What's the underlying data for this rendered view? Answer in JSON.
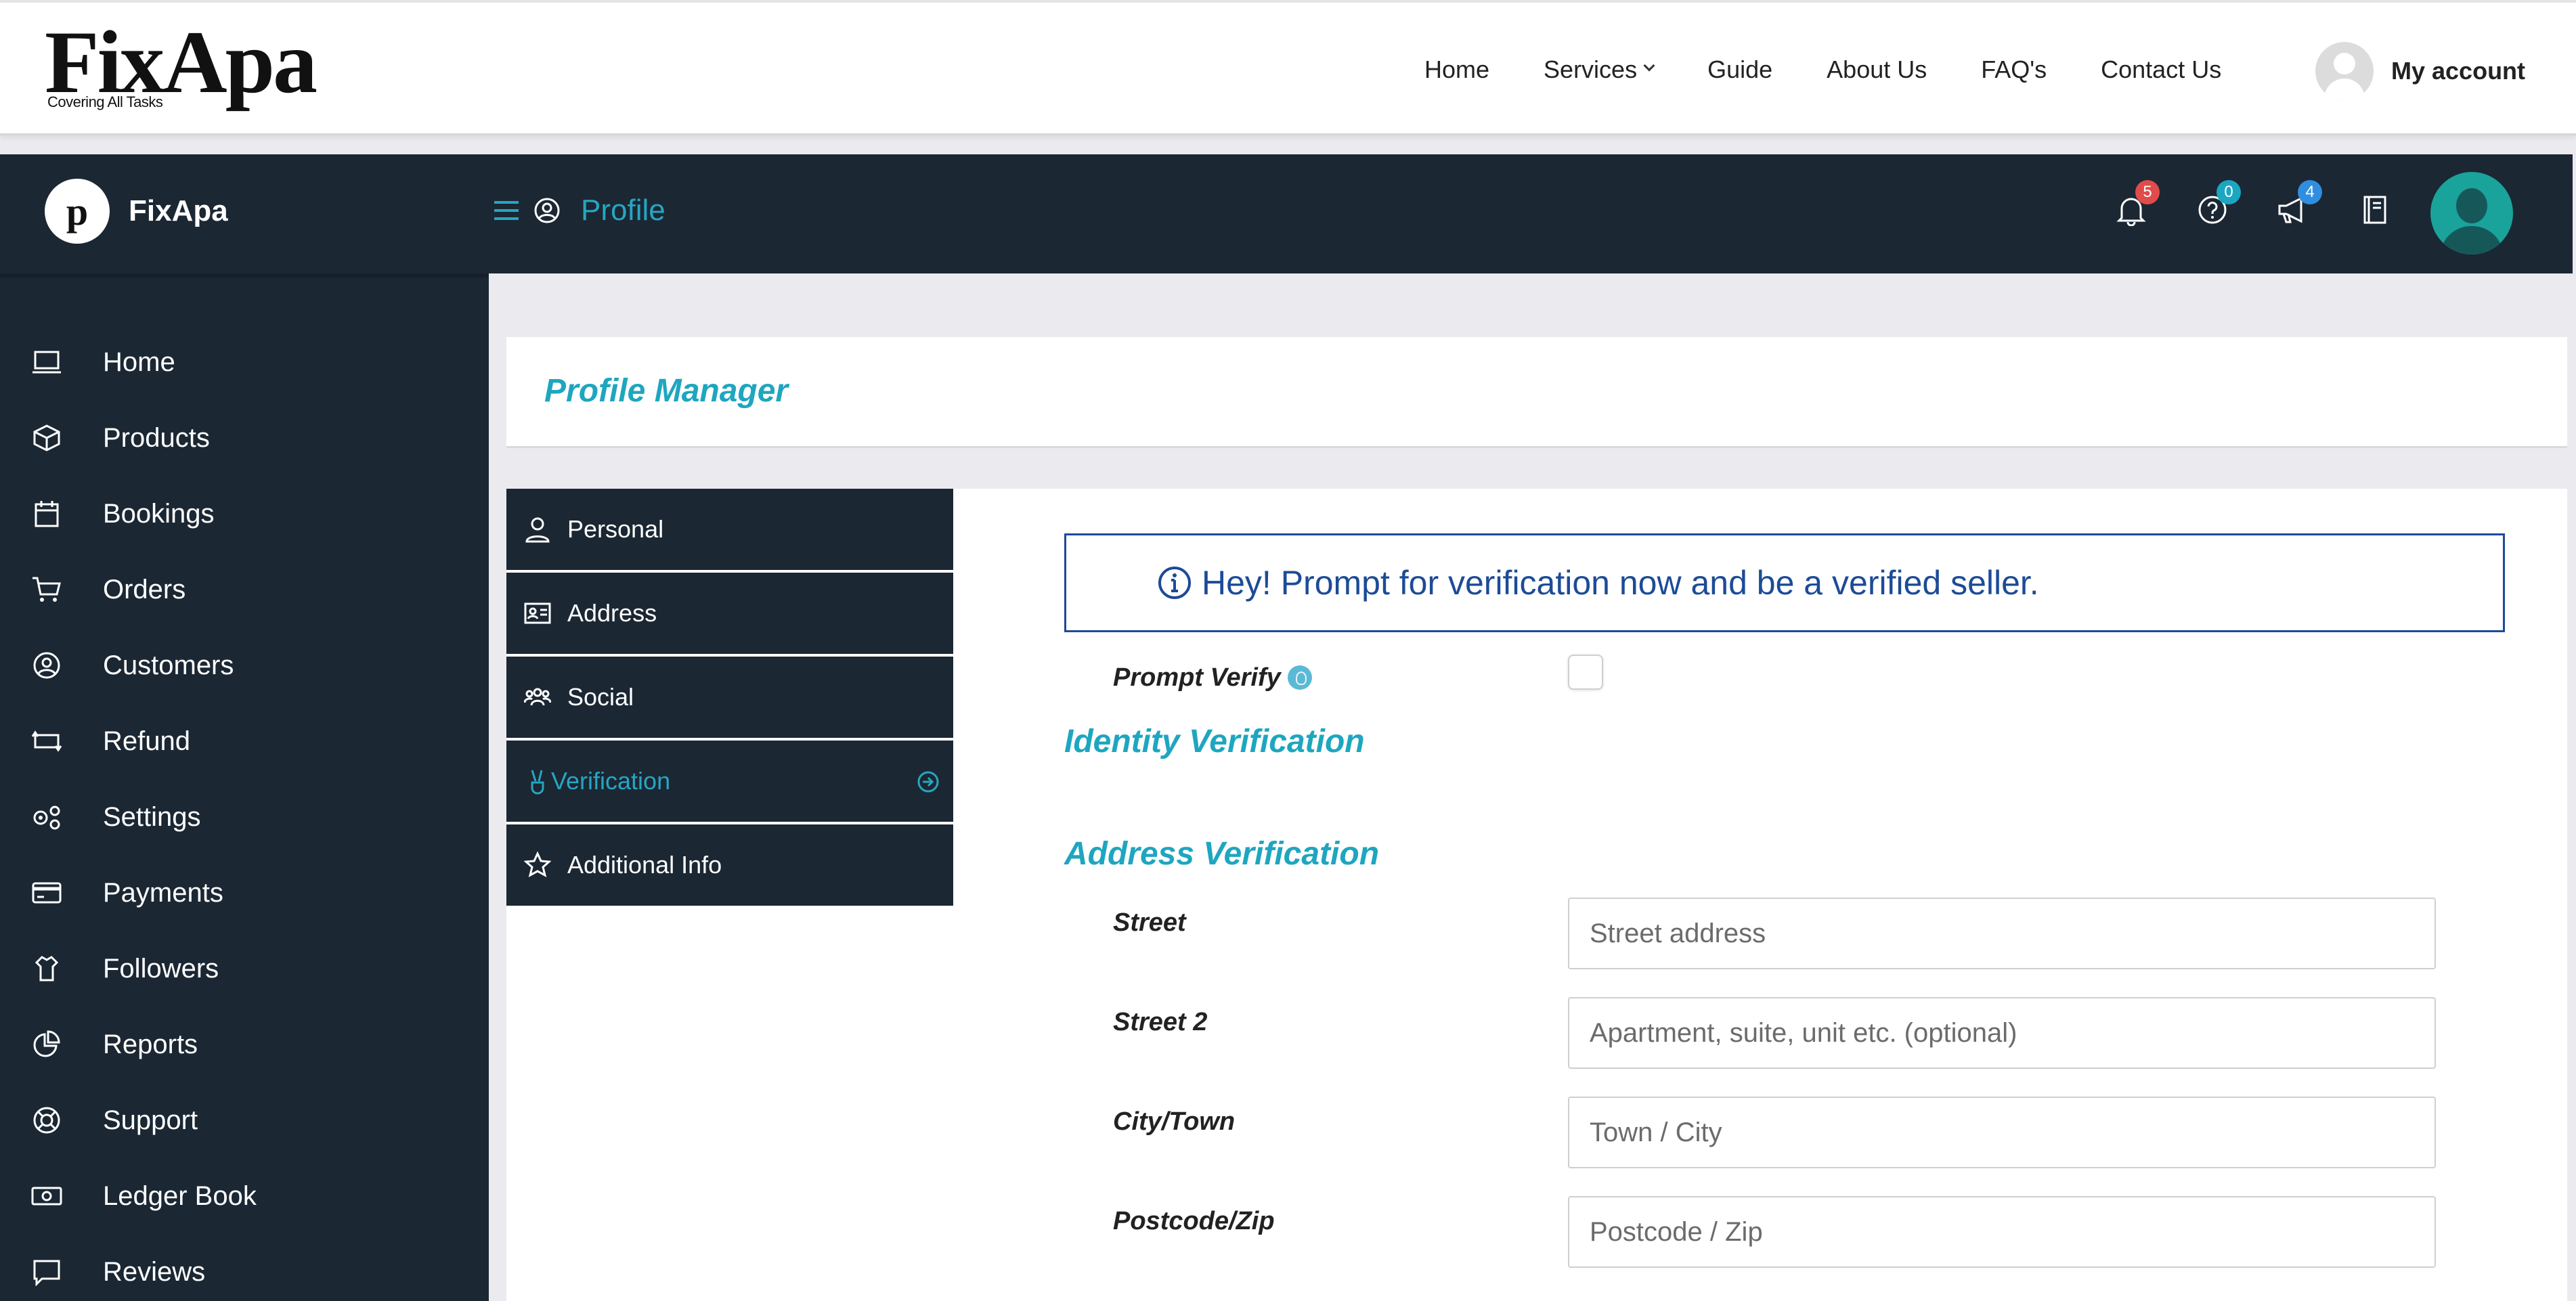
{
  "site": {
    "logo_text": "FixApa",
    "logo_tagline": "Covering All Tasks",
    "nav": [
      "Home",
      "Services",
      "Guide",
      "About Us",
      "FAQ's",
      "Contact Us"
    ],
    "account_label": "My account"
  },
  "dashboard": {
    "brand_initial": "p",
    "brand_name": "FixApa",
    "page_title": "Profile",
    "badges": {
      "notifications": "5",
      "help": "0",
      "announcements": "4"
    },
    "colors": {
      "dark": "#1b2733",
      "accent": "#26a6c1",
      "notice": "#1c4b97",
      "badge_red": "#e04b4b",
      "badge_teal": "#1ba6c2",
      "badge_blue": "#2f8ee0"
    }
  },
  "sidebar": {
    "items": [
      {
        "label": "Home",
        "icon": "laptop-icon"
      },
      {
        "label": "Products",
        "icon": "box-icon"
      },
      {
        "label": "Bookings",
        "icon": "calendar-icon"
      },
      {
        "label": "Orders",
        "icon": "cart-icon"
      },
      {
        "label": "Customers",
        "icon": "user-circle-icon"
      },
      {
        "label": "Refund",
        "icon": "refund-icon"
      },
      {
        "label": "Settings",
        "icon": "gears-icon"
      },
      {
        "label": "Payments",
        "icon": "credit-card-icon"
      },
      {
        "label": "Followers",
        "icon": "followers-icon"
      },
      {
        "label": "Reports",
        "icon": "pie-chart-icon"
      },
      {
        "label": "Support",
        "icon": "lifebuoy-icon"
      },
      {
        "label": "Ledger Book",
        "icon": "money-icon"
      },
      {
        "label": "Reviews",
        "icon": "comment-icon"
      }
    ]
  },
  "main": {
    "title": "Profile Manager",
    "tabs": [
      {
        "label": "Personal",
        "icon": "user-icon"
      },
      {
        "label": "Address",
        "icon": "address-card-icon"
      },
      {
        "label": "Social",
        "icon": "users-icon"
      },
      {
        "label": "Verification",
        "icon": "peace-hand-icon",
        "active": true
      },
      {
        "label": "Additional Info",
        "icon": "star-icon"
      }
    ],
    "notice": "Hey! Prompt for verification now and be a verified seller.",
    "prompt_verify_label": "Prompt Verify",
    "prompt_verify_checked": false,
    "identity_title": "Identity Verification",
    "address_title": "Address Verification",
    "fields": [
      {
        "label": "Street",
        "placeholder": "Street address",
        "value": ""
      },
      {
        "label": "Street 2",
        "placeholder": "Apartment, suite, unit etc. (optional)",
        "value": ""
      },
      {
        "label": "City/Town",
        "placeholder": "Town / City",
        "value": ""
      },
      {
        "label": "Postcode/Zip",
        "placeholder": "Postcode / Zip",
        "value": ""
      }
    ]
  }
}
